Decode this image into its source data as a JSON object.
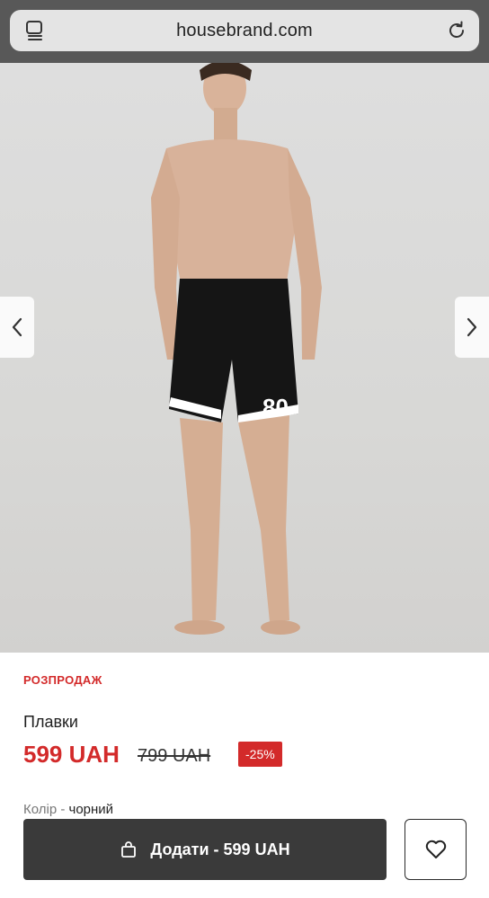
{
  "browser": {
    "url": "housebrand.com"
  },
  "product": {
    "badge": "РОЗПРОДАЖ",
    "name": "Плавки",
    "price": "599 UAH",
    "old_price": "799 UAH",
    "discount": "-25%",
    "color_label": "Колір - ",
    "color_value": "чорний",
    "add_to_cart_label": "Додати - 599 UAH"
  },
  "colors": {
    "sale_red": "#d32a2a",
    "button_dark": "#3a3a3a"
  }
}
